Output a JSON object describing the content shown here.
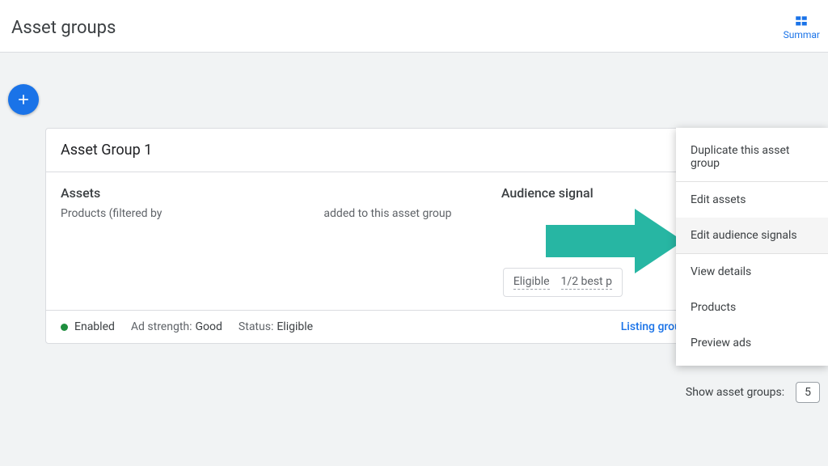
{
  "header": {
    "title": "Asset groups",
    "summary_label": "Summar"
  },
  "card": {
    "title": "Asset Group 1",
    "preview_label": "Preview ads",
    "assets_heading": "Assets",
    "assets_sub_left": "Products (filtered by",
    "assets_sub_mid": "added to this asset group",
    "audience_heading": "Audience signal",
    "status_eligible": "Eligible",
    "status_best": "1/2 best p"
  },
  "footer": {
    "enabled": "Enabled",
    "ad_strength_label": "Ad strength:",
    "ad_strength_val": "Good",
    "status_label": "Status:",
    "status_val": "Eligible",
    "listing": "Listing groups"
  },
  "menu": {
    "duplicate": "Duplicate this asset group",
    "edit_assets": "Edit assets",
    "edit_signals": "Edit audience signals",
    "view_details": "View details",
    "products": "Products",
    "preview_ads": "Preview ads"
  },
  "pager": {
    "label": "Show asset groups:",
    "value": "5"
  }
}
